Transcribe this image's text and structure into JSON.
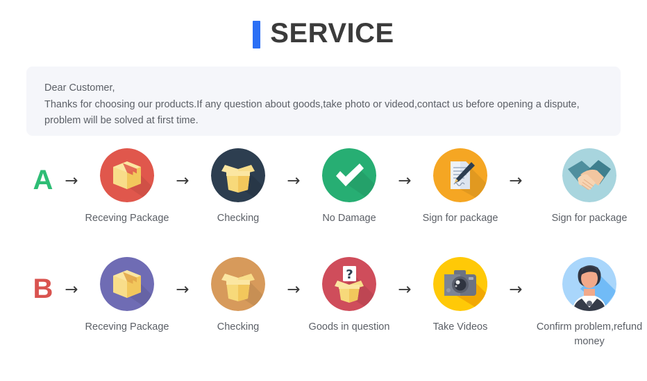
{
  "header": {
    "title": "SERVICE",
    "accent_color": "#2b6ff5"
  },
  "notice": {
    "lines": [
      "Dear Customer,",
      "Thanks for choosing our products.If any question about goods,take photo or videod,contact us before opening a dispute,",
      "problem will be solved at first time."
    ],
    "background": "#f5f6fa"
  },
  "arrow_glyph": "→",
  "flows": [
    {
      "letter": "A",
      "letter_color": "#2ebd75",
      "steps": [
        {
          "label": "Receving Package",
          "icon": "closed-box-icon",
          "circle_color": "#e0574c"
        },
        {
          "label": "Checking",
          "icon": "open-box-icon",
          "circle_color": "#2d3e50"
        },
        {
          "label": "No Damage",
          "icon": "check-mark-icon",
          "circle_color": "#27ae73"
        },
        {
          "label": "Sign for package",
          "icon": "document-pen-icon",
          "circle_color": "#f5a623"
        },
        {
          "label": "Sign for package",
          "icon": "handshake-icon",
          "circle_color": "#a8d5de"
        }
      ]
    },
    {
      "letter": "B",
      "letter_color": "#d9534f",
      "steps": [
        {
          "label": "Receving Package",
          "icon": "closed-box-icon",
          "circle_color": "#6f6cb4"
        },
        {
          "label": "Checking",
          "icon": "open-box-icon",
          "circle_color": "#d79a5b"
        },
        {
          "label": "Goods in question",
          "icon": "question-box-icon",
          "circle_color": "#cf4d5b"
        },
        {
          "label": "Take Videos",
          "icon": "camera-icon",
          "circle_color": "#ffc907"
        },
        {
          "label": "Confirm  problem,refund money",
          "icon": "person-avatar-icon",
          "circle_color": "#8fc9f7"
        }
      ]
    }
  ]
}
